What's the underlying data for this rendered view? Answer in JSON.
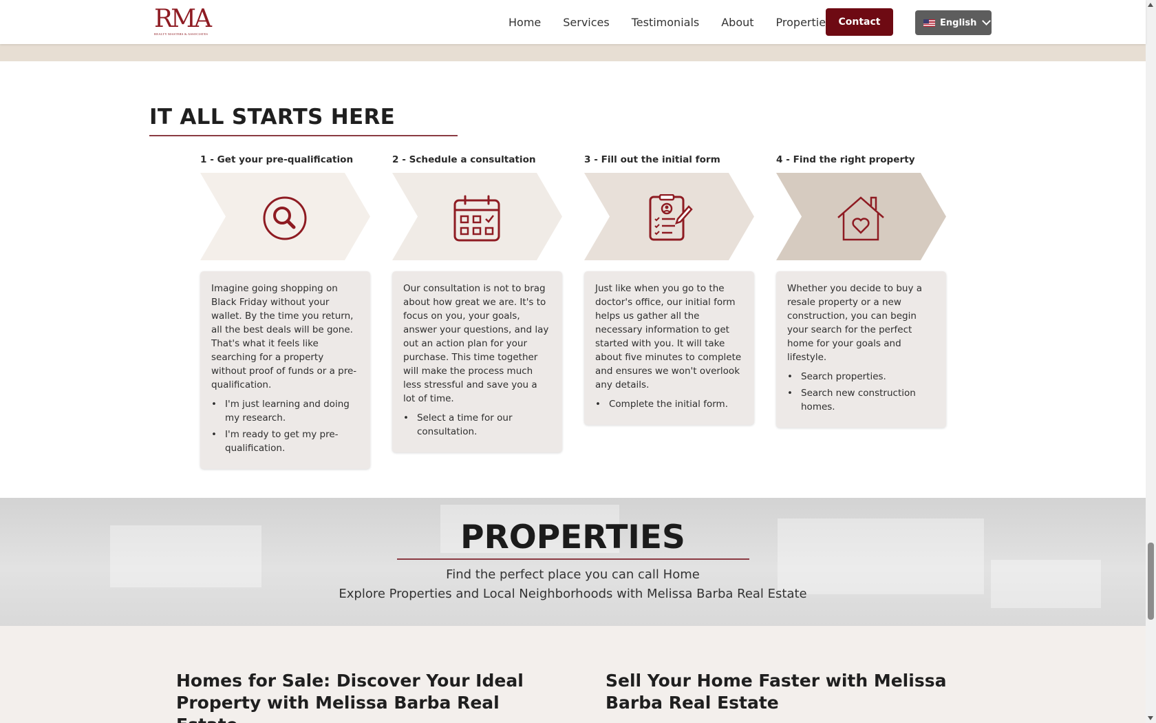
{
  "header": {
    "logo_text": "RMA",
    "logo_subtext": "REALTY MASTERS & ASSOCIATES",
    "nav": [
      "Home",
      "Services",
      "Testimonials",
      "About",
      "Properties"
    ],
    "contact_label": "Contact",
    "language": "English"
  },
  "steps_section": {
    "title": "IT ALL STARTS HERE",
    "steps": [
      {
        "label": "1 - Get your pre-qualification",
        "icon": "magnifier-icon",
        "chevron_color": "#f4efea",
        "text": "Imagine going shopping on Black Friday without your wallet. By the time you return, all the best deals will be gone. That's what it feels like searching for a property without proof of funds or a pre-qualification.",
        "bullets": [
          "I'm just learning and doing my research.",
          "I'm ready to get my pre-qualification."
        ]
      },
      {
        "label": "2 - Schedule a consultation",
        "icon": "calendar-icon",
        "chevron_color": "#f0ebe6",
        "text": "Our consultation is not to brag about how great we are. It's to focus on you, your goals, answer your questions, and lay out an action plan for your purchase. This time together will make the process much less stressful and save you a lot of time.",
        "bullets": [
          "Select a time for our consultation."
        ]
      },
      {
        "label": "3 - Fill out the initial form",
        "icon": "clipboard-form-icon",
        "chevron_color": "#e8e0d9",
        "text": "Just like when you go to the doctor's office, our initial form helps us gather all the necessary information to get started with you. It will take about five minutes to complete and ensures we won't overlook any details.",
        "bullets": [
          "Complete the initial form."
        ]
      },
      {
        "label": "4 - Find the right property",
        "icon": "house-heart-icon",
        "chevron_color": "#d6cbc0",
        "text": "Whether you decide to buy a resale property or a new construction, you can begin your search for the perfect home for your goals and lifestyle.",
        "bullets": [
          "Search properties.",
          "Search new construction homes."
        ]
      }
    ]
  },
  "properties": {
    "title": "PROPERTIES",
    "subtitle1": "Find the perfect place you can call Home",
    "subtitle2": "Explore Properties and Local Neighborhoods with Melissa Barba Real Estate"
  },
  "bottom": {
    "left_heading": "Homes for Sale: Discover Your Ideal Property with Melissa Barba Real Estate",
    "right_heading": "Sell Your Home Faster with Melissa Barba Real Estate"
  },
  "colors": {
    "brand": "#6e0a13",
    "icon": "#8e1b22",
    "accent_rule": "#8a3a42"
  }
}
